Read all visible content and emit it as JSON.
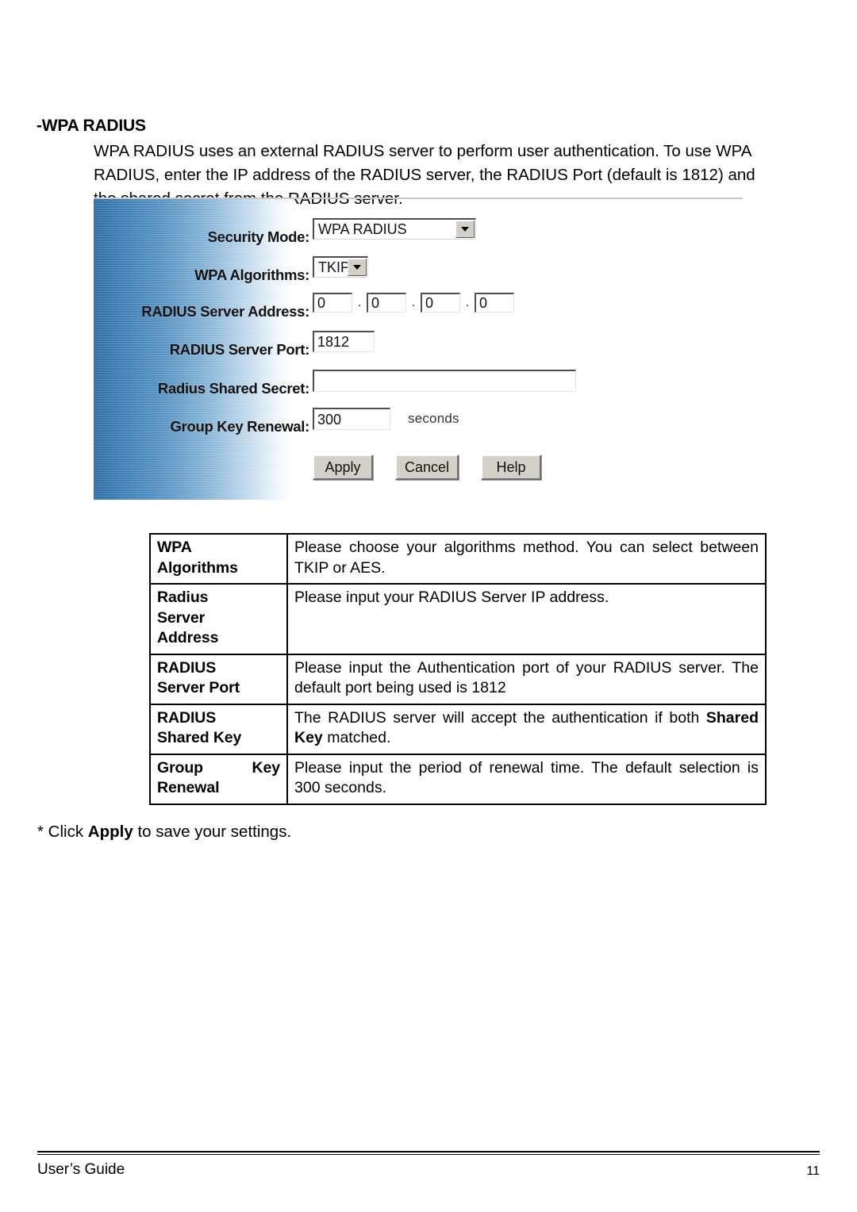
{
  "page": {
    "heading": "-WPA RADIUS",
    "intro_line1": "WPA RADIUS uses an external RADIUS server to perform user authentication. To use WPA",
    "intro_line2": "RADIUS, enter the IP address of the RADIUS server, the RADIUS Port (default is 1812) and",
    "intro_line3": "the shared secret from the RADIUS server."
  },
  "theme": {
    "panel_gradient_start": "#2f6ea6",
    "panel_gradient_end": "#ffffff",
    "button_face": "#d4d0c8",
    "text": "#000000"
  },
  "form": {
    "security_mode": {
      "label": "Security Mode:",
      "value": "WPA RADIUS",
      "options": [
        "WPA RADIUS"
      ]
    },
    "wpa_algorithms": {
      "label": "WPA Algorithms:",
      "value": "TKIP",
      "options": [
        "TKIP",
        "AES"
      ]
    },
    "radius_server_address": {
      "label": "RADIUS Server Address:",
      "octets": [
        "0",
        "0",
        "0",
        "0"
      ],
      "separator": "."
    },
    "radius_server_port": {
      "label": "RADIUS Server Port:",
      "value": "1812"
    },
    "radius_shared_secret": {
      "label": "Radius Shared Secret:",
      "value": ""
    },
    "group_key_renewal": {
      "label": "Group Key Renewal:",
      "value": "300",
      "units": "seconds"
    },
    "buttons": {
      "apply": "Apply",
      "cancel": "Cancel",
      "help": "Help"
    }
  },
  "table": {
    "rows": [
      {
        "term_line1": "WPA",
        "term_line2": "Algorithms",
        "desc_line1": "Please choose your algorithms method. You can select",
        "desc_line2": "between TKIP or AES."
      },
      {
        "term_line1": "Radius",
        "term_line2": "Server",
        "term_line3": "Address",
        "desc_line1": "Please input your RADIUS Server IP address.",
        "desc_line2": ""
      },
      {
        "term_line1": "RADIUS",
        "term_line2": "Server Port",
        "desc_line1": "Please input the Authentication port of your RADIUS server.",
        "desc_line2": "The default port being used is 1812"
      },
      {
        "term_line1": "RADIUS",
        "term_line2": "Shared Key",
        "desc_line1": "The RADIUS server will accept the authentication if both",
        "desc_bold": "Shared Key",
        "desc_line2_tail": " matched."
      },
      {
        "term_line1": "Group",
        "term_line1b": "Key",
        "term_line2": "Renewal",
        "desc_line1": "Please input the period of renewal time. The default selection",
        "desc_line2": "is 300 seconds."
      }
    ]
  },
  "note": {
    "prefix": "* Click ",
    "bold": "Apply",
    "suffix": " to save your settings."
  },
  "footer": {
    "left": "User’s Guide",
    "page_number": "11"
  }
}
